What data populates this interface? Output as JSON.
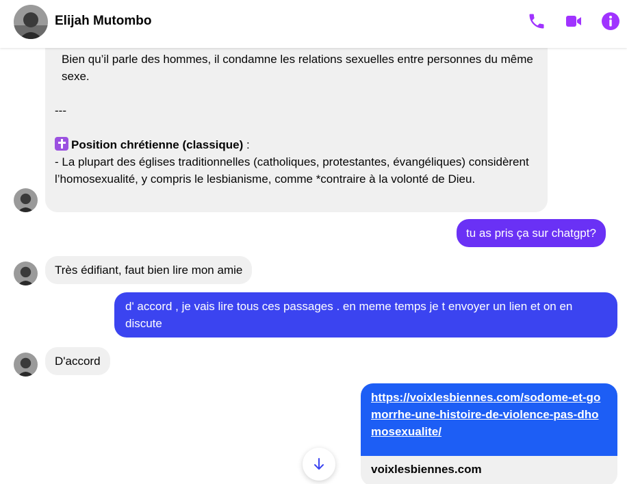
{
  "header": {
    "contact_name": "Elijah Mutombo",
    "icons": [
      "phone-icon",
      "video-icon",
      "info-icon"
    ],
    "accent_color": "#a033ff"
  },
  "messages": {
    "m1": {
      "line_intro": "Bien qu’il parle des hommes, il condamne les relations sexuelles entre personnes du même sexe.",
      "separator": "---",
      "bold": "Position chrétienne (classique)",
      "after_bold": " :",
      "body": "- La plupart des églises traditionnelles (catholiques, protestantes, évangéliques) considèrent l’homosexualité, y compris le lesbianisme, comme *contraire à la volonté de Dieu."
    },
    "m2": "tu as pris ça sur chatgpt?",
    "m3": "Très édifiant, faut bien lire mon amie",
    "m4": "d' accord , je vais lire tous ces passages . en meme temps je t envoyer un lien et on en discute",
    "m5": "D'accord",
    "link": {
      "url": "https://voixlesbiennes.com/sodome-et-gomorrhe-une-histoire-de-violence-pas-dhomosexualite/",
      "domain": "voixlesbiennes.com"
    }
  },
  "colors": {
    "bubble_in": "#f0f0f0",
    "bubble_out_1": "#6a31f5",
    "bubble_out_2": "#3b44f0",
    "link_bubble": "#1d5ef5"
  }
}
